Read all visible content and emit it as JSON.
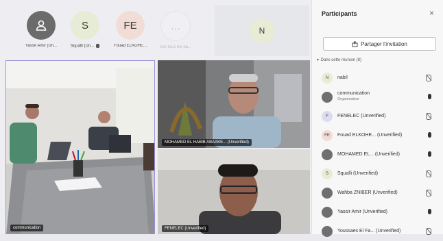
{
  "top_tiles": [
    {
      "initials": "",
      "name": "Yassir Amir (Un...",
      "color": "#6b6b6b",
      "icon": "person-icon",
      "muted": false
    },
    {
      "initials": "S",
      "name": "Squalli (Un...",
      "color": "#e6ecd6",
      "icon": "",
      "muted": true
    },
    {
      "initials": "FE",
      "name": "Fouad ELKOHE...",
      "color": "#f2ddd6",
      "icon": "",
      "muted": false
    },
    {
      "initials": "…",
      "name": "Voir tous les pa...",
      "color": "#eeeef2",
      "icon": "more-icon",
      "muted": false
    }
  ],
  "side_tile": {
    "initials": "N"
  },
  "videos": [
    {
      "label": "communication"
    },
    {
      "label": "MOHAMED EL HABIB ABAAKE... (Unverified)"
    },
    {
      "label": "FENELEC (Unverified)"
    }
  ],
  "panel": {
    "title": "Participants",
    "close": "×",
    "share_label": "Partager l'invitation",
    "section_label": "Dans cette réunion (8)",
    "participants": [
      {
        "initials": "N",
        "name": "nabil",
        "role": "",
        "color": "#e8ecd2",
        "mic": "muted"
      },
      {
        "initials": "",
        "name": "communication",
        "role": "Organisateur",
        "color": "#6f6f6f",
        "mic": "on"
      },
      {
        "initials": "F",
        "name": "FENELEC (Unverified)",
        "role": "",
        "color": "#dcdcf0",
        "mic": "muted"
      },
      {
        "initials": "FE",
        "name": "Fouad ELKOHE... (Unverified)",
        "role": "",
        "color": "#f2ddd6",
        "mic": "on"
      },
      {
        "initials": "",
        "name": "MOHAMED EL... (Unverified)",
        "role": "",
        "color": "#6f6f6f",
        "mic": "on"
      },
      {
        "initials": "S",
        "name": "Squalli (Unverified)",
        "role": "",
        "color": "#e6ecd6",
        "mic": "muted"
      },
      {
        "initials": "",
        "name": "Wahba ZNIBER (Unverified)",
        "role": "",
        "color": "#6f6f6f",
        "mic": "muted"
      },
      {
        "initials": "",
        "name": "Yassir Amir (Unverified)",
        "role": "",
        "color": "#6f6f6f",
        "mic": "on"
      },
      {
        "initials": "",
        "name": "Youssaes El Fa... (Unverified)",
        "role": "",
        "color": "#6f6f6f",
        "mic": "muted"
      }
    ]
  }
}
